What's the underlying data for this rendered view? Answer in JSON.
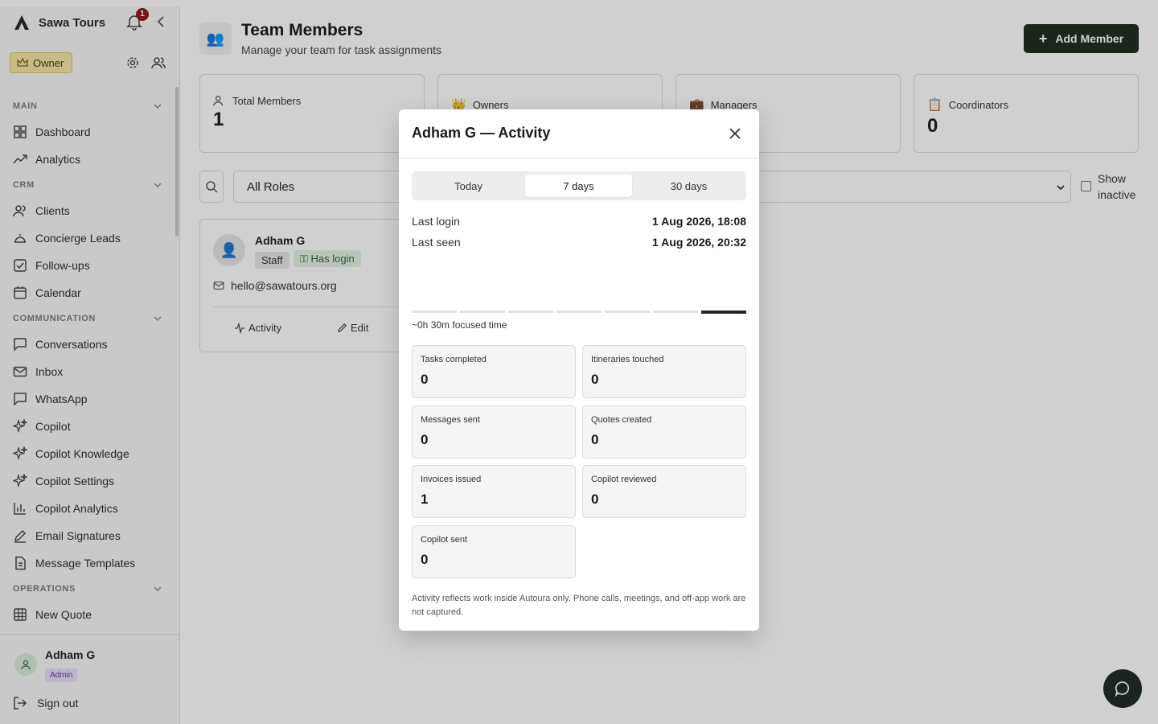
{
  "sidebar": {
    "brand": "Sawa Tours",
    "notification_count": "1",
    "owner_label": "Owner",
    "sections": {
      "main": "MAIN",
      "crm": "CRM",
      "communication": "COMMUNICATION",
      "operations": "OPERATIONS"
    },
    "items": {
      "dashboard": "Dashboard",
      "analytics": "Analytics",
      "clients": "Clients",
      "concierge": "Concierge Leads",
      "followups": "Follow-ups",
      "calendar": "Calendar",
      "conversations": "Conversations",
      "inbox": "Inbox",
      "whatsapp": "WhatsApp",
      "copilot": "Copilot",
      "copilot_knowledge": "Copilot Knowledge",
      "copilot_settings": "Copilot Settings",
      "copilot_analytics": "Copilot Analytics",
      "email_signatures": "Email Signatures",
      "message_templates": "Message Templates",
      "new_quote": "New Quote"
    },
    "user": {
      "name": "Adham G",
      "role": "Admin"
    },
    "sign_out": "Sign out"
  },
  "page": {
    "title": "Team Members",
    "subtitle": "Manage your team for task assignments",
    "add_button": "Add Member",
    "stats": [
      {
        "label": "Total Members",
        "value": "1"
      },
      {
        "label": "Owners",
        "value": ""
      },
      {
        "label": "Managers",
        "value": ""
      },
      {
        "label": "Coordinators",
        "value": "0"
      }
    ],
    "filter": {
      "role_selected": "All Roles",
      "show_inactive": "Show inactive"
    },
    "member": {
      "name": "Adham G",
      "role": "Staff",
      "login_badge": "Has login",
      "email": "hello@sawatours.org",
      "activity_label": "Activity",
      "edit_label": "Edit"
    }
  },
  "modal": {
    "title": "Adham G — Activity",
    "tabs": [
      "Today",
      "7 days",
      "30 days"
    ],
    "active_tab": "7 days",
    "last_login_label": "Last login",
    "last_login_value": "1 Aug 2026, 18:08",
    "last_seen_label": "Last seen",
    "last_seen_value": "1 Aug 2026, 20:32",
    "daily_activity": [
      0,
      0,
      0,
      0,
      0,
      0,
      1
    ],
    "focused_time": "~0h 30m focused time",
    "metrics": [
      {
        "label": "Tasks completed",
        "value": "0"
      },
      {
        "label": "Itineraries touched",
        "value": "0"
      },
      {
        "label": "Messages sent",
        "value": "0"
      },
      {
        "label": "Quotes created",
        "value": "0"
      },
      {
        "label": "Invoices issued",
        "value": "1"
      },
      {
        "label": "Copilot reviewed",
        "value": "0"
      },
      {
        "label": "Copilot sent",
        "value": "0"
      }
    ],
    "note": "Activity reflects work inside Autoura only. Phone calls, meetings, and off-app work are not captured."
  },
  "colors": {
    "accent": "#1f2a1f",
    "badge": "#8b1a1a",
    "owner_bg": "#f3e6a8"
  }
}
